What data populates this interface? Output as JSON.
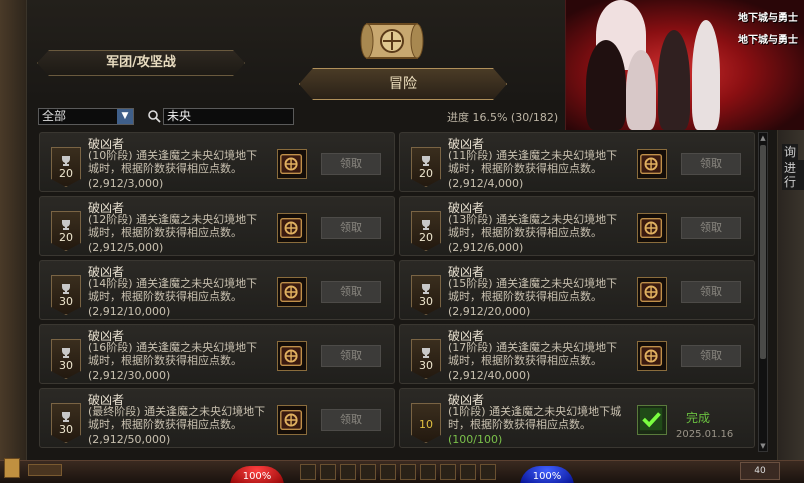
{
  "tabs": {
    "guild_label": "军团/攻坚战",
    "adventure_label": "冒险"
  },
  "filter": {
    "selected": "全部",
    "search_value": "未央"
  },
  "progress": {
    "text": "进度 16.5% (30/182)",
    "fraction": 0.165
  },
  "claim_label": "领取",
  "achievements": [
    {
      "title": "破凶者",
      "level": "20",
      "desc": "(10阶段) 通关逢魔之未央幻境地下城时，根据阶数获得相应点数。",
      "progress": "(2,912/3,000)",
      "done": false
    },
    {
      "title": "破凶者",
      "level": "20",
      "desc": "(11阶段) 通关逢魔之未央幻境地下城时，根据阶数获得相应点数。",
      "progress": "(2,912/4,000)",
      "done": false
    },
    {
      "title": "破凶者",
      "level": "20",
      "desc": "(12阶段) 通关逢魔之未央幻境地下城时，根据阶数获得相应点数。",
      "progress": "(2,912/5,000)",
      "done": false
    },
    {
      "title": "破凶者",
      "level": "20",
      "desc": "(13阶段) 通关逢魔之未央幻境地下城时，根据阶数获得相应点数。",
      "progress": "(2,912/6,000)",
      "done": false
    },
    {
      "title": "破凶者",
      "level": "30",
      "desc": "(14阶段) 通关逢魔之未央幻境地下城时，根据阶数获得相应点数。",
      "progress": "(2,912/10,000)",
      "done": false
    },
    {
      "title": "破凶者",
      "level": "30",
      "desc": "(15阶段) 通关逢魔之未央幻境地下城时，根据阶数获得相应点数。",
      "progress": "(2,912/20,000)",
      "done": false
    },
    {
      "title": "破凶者",
      "level": "30",
      "desc": "(16阶段) 通关逢魔之未央幻境地下城时，根据阶数获得相应点数。",
      "progress": "(2,912/30,000)",
      "done": false
    },
    {
      "title": "破凶者",
      "level": "30",
      "desc": "(17阶段) 通关逢魔之未央幻境地下城时，根据阶数获得相应点数。",
      "progress": "(2,912/40,000)",
      "done": false
    },
    {
      "title": "破凶者",
      "level": "30",
      "desc": "(最终阶段) 通关逢魔之未央幻境地下城时，根据阶数获得相应点数。",
      "progress": "(2,912/50,000)",
      "done": false
    },
    {
      "title": "破凶者",
      "level": "10",
      "desc": "(1阶段) 通关逢魔之未央幻境地下城时，根据阶数获得相应点数。",
      "progress": "(100/100)",
      "done": true,
      "done_label": "完成",
      "done_date": "2025.01.16"
    }
  ],
  "banner": {
    "logo_lines": [
      "地下城与勇士",
      "地下城与勇士"
    ]
  },
  "side_snippets": [
    "询",
    "进行"
  ],
  "hud": {
    "hp_text": "100%",
    "mp_text": "100%",
    "gold_text": "40"
  },
  "colors": {
    "accent_gold": "#b0905a",
    "done_green": "#6ac040",
    "hp_red": "#ff4040",
    "mp_blue": "#4060ff"
  },
  "icons": [
    "trophy-icon",
    "reward-chest-icon",
    "checkmark-icon",
    "scroll-compass-icon",
    "search-icon",
    "chevron-down-icon"
  ]
}
